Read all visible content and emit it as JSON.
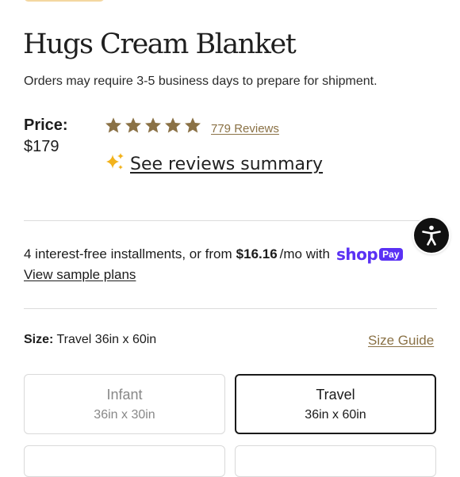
{
  "product": {
    "title": "Hugs Cream Blanket",
    "notice": "Orders may require 3-5 business days to prepare for shipment."
  },
  "price": {
    "label": "Price:",
    "value": "$179"
  },
  "rating": {
    "stars": 5,
    "star_color": "#8a7145",
    "reviews_link": "779 Reviews",
    "summary_link": "See reviews summary",
    "summary_icon": "sparkle-icon"
  },
  "installments": {
    "text_before": "4 interest-free installments, or from",
    "amount": "$16.16",
    "text_after": "/mo with",
    "brand_word": "shop",
    "brand_badge": "Pay",
    "brand_color": "#5a31f4",
    "sample_link": "View sample plans"
  },
  "accessibility": {
    "icon": "accessibility-icon"
  },
  "size": {
    "label": "Size:",
    "selected_value": "Travel 36in x 60in",
    "guide_link": "Size Guide",
    "options": [
      {
        "name": "Infant",
        "dims": "36in x 30in",
        "selected": false
      },
      {
        "name": "Travel",
        "dims": "36in x 60in",
        "selected": true
      }
    ]
  }
}
